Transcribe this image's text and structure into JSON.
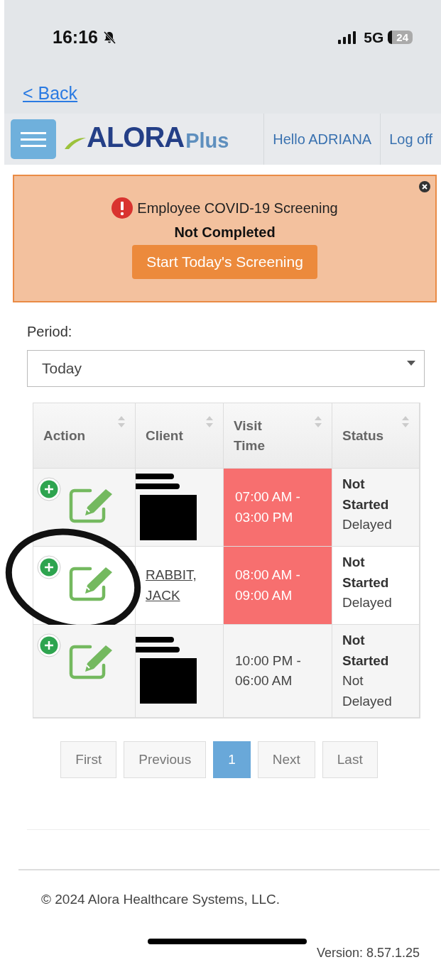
{
  "status_bar": {
    "time": "16:16",
    "network": "5G",
    "battery": "24"
  },
  "back_link": "< Back",
  "header": {
    "logo_main": "ALORA",
    "logo_sub": "Plus",
    "greeting": "Hello ADRIANA",
    "logout": "Log off"
  },
  "alert": {
    "title": "Employee COVID-19 Screening",
    "subtitle": "Not Completed",
    "button": "Start Today's Screening"
  },
  "period": {
    "label": "Period:",
    "value": "Today"
  },
  "table": {
    "columns": [
      "Action",
      "Client",
      "Visit Time",
      "Status"
    ],
    "rows": [
      {
        "client": {
          "kind": "redacted"
        },
        "visit_time": "07:00 AM - 03:00 PM",
        "late": true,
        "status": "Not Started",
        "delay": "Delayed",
        "circled": false
      },
      {
        "client": {
          "kind": "link",
          "name": "RABBIT, JACK"
        },
        "visit_time": "08:00 AM - 09:00 AM",
        "late": true,
        "status": "Not Started",
        "delay": "Delayed",
        "circled": true
      },
      {
        "client": {
          "kind": "redacted"
        },
        "visit_time": "10:00 PM - 06:00 AM",
        "late": false,
        "status": "Not Started",
        "delay": "Not Delayed",
        "circled": false
      }
    ]
  },
  "pagination": [
    {
      "label": "First",
      "selected": false
    },
    {
      "label": "Previous",
      "selected": false
    },
    {
      "label": "1",
      "selected": true
    },
    {
      "label": "Next",
      "selected": false
    },
    {
      "label": "Last",
      "selected": false
    }
  ],
  "footer": {
    "copyright": "© 2024 Alora Healthcare Systems, LLC.",
    "version": "Version: 8.57.1.25"
  }
}
